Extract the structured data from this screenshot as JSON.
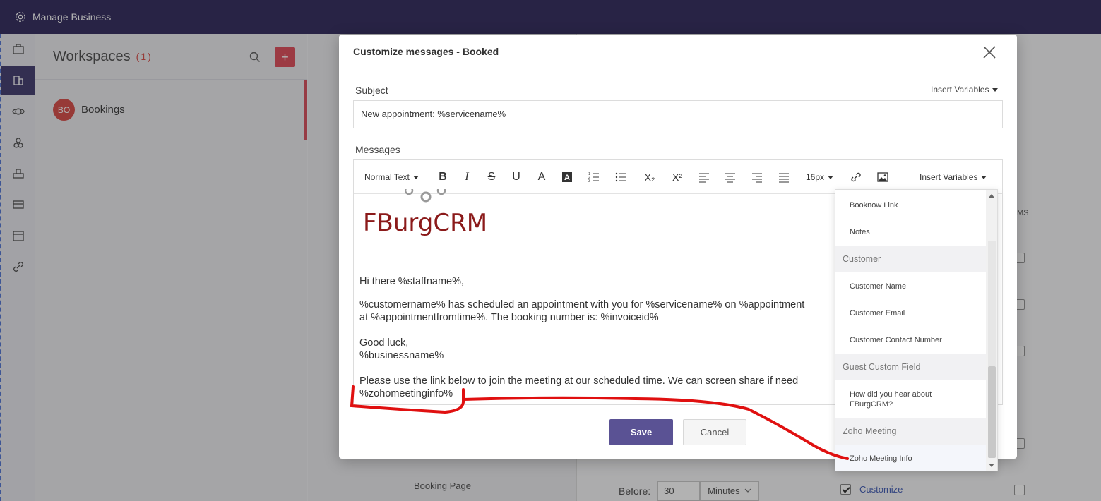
{
  "topbar": {
    "title": "Manage Business"
  },
  "workspaces": {
    "title": "Workspaces",
    "count": "(1)",
    "items": [
      {
        "initials": "BO",
        "name": "Bookings"
      }
    ]
  },
  "background": {
    "booking_page": "Booking Page",
    "before_label": "Before:",
    "before_value": "30",
    "before_unit": "Minutes",
    "customize_label": "Customize",
    "ms_label": "MS"
  },
  "modal": {
    "title": "Customize messages - Booked",
    "subject_label": "Subject",
    "insert_variables": "Insert Variables",
    "subject_value": "New appointment: %servicename%",
    "messages_label": "Messages",
    "toolbar": {
      "text_style": "Normal Text",
      "font_size": "16px",
      "insert_variables": "Insert Variables"
    },
    "body": {
      "logo_text": "FBurgCRM",
      "greeting": "Hi there %staffname%,",
      "line1": "%customername% has scheduled an appointment with you for %servicename% on %appointment",
      "line2": "at %appointmentfromtime%. The booking number is: %invoiceid%",
      "signoff1": "Good luck,",
      "signoff2": "%businessname%",
      "meeting1": "Please use the link below to join the meeting at our scheduled time. We can screen share if need",
      "meeting2": "%zohomeetinginfo%"
    },
    "save_label": "Save",
    "cancel_label": "Cancel"
  },
  "variables_dropdown": {
    "items": [
      {
        "kind": "item",
        "label": "Booknow Link"
      },
      {
        "kind": "item",
        "label": "Notes"
      },
      {
        "kind": "group",
        "label": "Customer"
      },
      {
        "kind": "item",
        "label": "Customer Name"
      },
      {
        "kind": "item",
        "label": "Customer Email"
      },
      {
        "kind": "item",
        "label": "Customer Contact Number"
      },
      {
        "kind": "group",
        "label": "Guest Custom Field"
      },
      {
        "kind": "item",
        "label": "How did you hear about FBurgCRM?"
      },
      {
        "kind": "group",
        "label": "Zoho Meeting"
      },
      {
        "kind": "item",
        "label": "Zoho Meeting Info"
      }
    ]
  },
  "colors": {
    "topbar": "#3a3363",
    "primary": "#5a5294",
    "accent_red": "#d9534f",
    "logo": "#8b1a1a",
    "annotation": "#e01010"
  }
}
